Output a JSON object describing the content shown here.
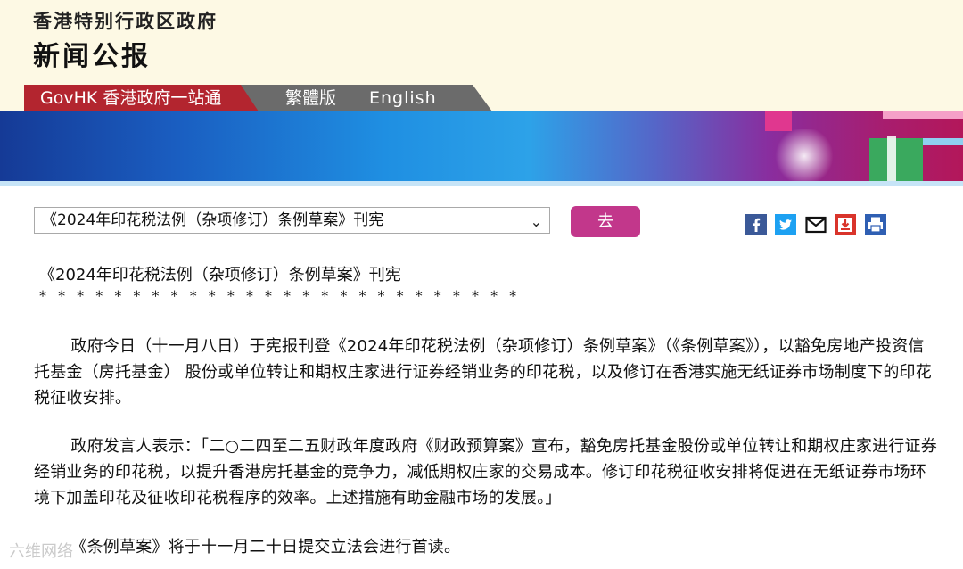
{
  "header": {
    "gov_name": "香港特别行政区政府",
    "title": "新闻公报"
  },
  "nav": {
    "govhk": "GovHK 香港政府一站通",
    "traditional": "繁體版",
    "english": "English"
  },
  "selector": {
    "selected": "《2024年印花税法例（杂项修订）条例草案》刊宪",
    "go_label": "去"
  },
  "share_icons": [
    "facebook-icon",
    "twitter-icon",
    "email-icon",
    "bookmark-icon",
    "print-icon"
  ],
  "article": {
    "title": "《2024年印花税法例（杂项修订）条例草案》刊宪",
    "stars": "* * * * * * * * * * * * * * * * * * * * * * * * * *",
    "paragraphs": [
      "政府今日（十一月八日）于宪报刊登《2024年印花税法例（杂项修订）条例草案》（《条例草案》），以豁免房地产投资信托基金（房托基金） 股份或单位转让和期权庄家进行证券经销业务的印花税，以及修订在香港实施无纸证券市场制度下的印花税征收安排。",
      "政府发言人表示：「二○二四至二五财政年度政府《财政预算案》宣布，豁免房托基金股份或单位转让和期权庄家进行证券经销业务的印花税，以提升香港房托基金的竞争力，减低期权庄家的交易成本。修订印花税征收安排将促进在无纸证券市场环境下加盖印花及征收印花税程序的效率。上述措施有助金融市场的发展。」",
      "《条例草案》将于十一月二十日提交立法会进行首读。"
    ]
  },
  "watermark": "六维网络",
  "colors": {
    "header_bg": "#fdf9e4",
    "govhk_red": "#b3252f",
    "nav_grey": "#6b6b6b",
    "go_button": "#c2378b"
  }
}
